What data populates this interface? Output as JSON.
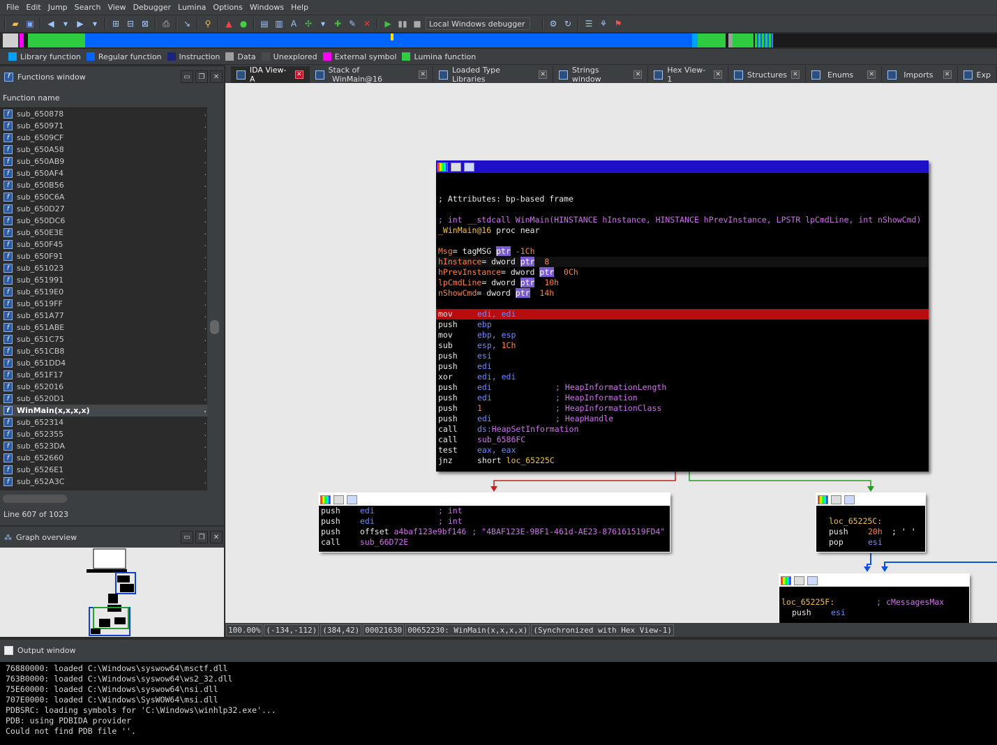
{
  "menu": [
    "File",
    "Edit",
    "Jump",
    "Search",
    "View",
    "Debugger",
    "Lumina",
    "Options",
    "Windows",
    "Help"
  ],
  "toolbar": {
    "debugger": "Local Windows debugger"
  },
  "legend": [
    {
      "label": "Library function",
      "color": "#00a0ff"
    },
    {
      "label": "Regular function",
      "color": "#0064ff"
    },
    {
      "label": "Instruction",
      "color": "#1a237e"
    },
    {
      "label": "Data",
      "color": "#9e9e9e"
    },
    {
      "label": "Unexplored",
      "color": "#4a4a4a"
    },
    {
      "label": "External symbol",
      "color": "#ff00ff"
    },
    {
      "label": "Lumina function",
      "color": "#2ecc40"
    }
  ],
  "functions_window": {
    "title": "Functions window",
    "column": "Function name",
    "items": [
      "sub_650878",
      "sub_650971",
      "sub_6509CF",
      "sub_650A58",
      "sub_650AB9",
      "sub_650AF4",
      "sub_650B56",
      "sub_650C6A",
      "sub_650D27",
      "sub_650DC6",
      "sub_650E3E",
      "sub_650F45",
      "sub_650F91",
      "sub_651023",
      "sub_651991",
      "sub_6519E0",
      "sub_6519FF",
      "sub_651A77",
      "sub_651ABE",
      "sub_651C75",
      "sub_651CB8",
      "sub_651DD4",
      "sub_651F17",
      "sub_652016",
      "sub_6520D1",
      "WinMain(x,x,x,x)",
      "sub_652314",
      "sub_652355",
      "sub_6523DA",
      "sub_652660",
      "sub_6526E1",
      "sub_652A3C"
    ],
    "line_status": "Line 607 of 1023"
  },
  "graph_overview": {
    "title": "Graph overview"
  },
  "tabs": [
    "IDA View-A",
    "Stack of _WinMain@16",
    "Loaded Type Libraries",
    "Strings window",
    "Hex View-1",
    "Structures",
    "Enums",
    "Imports",
    "Exp"
  ],
  "nodes": {
    "main": {
      "attributes": "; Attributes: bp-based frame",
      "proto_a": "; int __stdcall ",
      "proto_name": "WinMain",
      "proto_b": "(HINSTANCE hInstance, HINSTANCE hPrevInstance, LPSTR lpCmdLine, int nShowCmd)",
      "proc_name": "_WinMain@16",
      "proc_tail": " proc near",
      "vars": [
        {
          "name": "Msg",
          "type": "= tagMSG ",
          "ptr": "ptr",
          "val": " -1Ch"
        },
        {
          "name": "hInstance",
          "type": "= dword ",
          "ptr": "ptr",
          "val": "  8"
        },
        {
          "name": "hPrevInstance",
          "type": "= dword ",
          "ptr": "ptr",
          "val": "  0Ch"
        },
        {
          "name": "lpCmdLine",
          "type": "= dword ",
          "ptr": "ptr",
          "val": "  10h"
        },
        {
          "name": "nShowCmd",
          "type": "= dword ",
          "ptr": "ptr",
          "val": "  14h"
        }
      ],
      "code": [
        {
          "m": "mov",
          "a": "edi, edi",
          "c": ""
        },
        {
          "m": "push",
          "a": "ebp",
          "c": ""
        },
        {
          "m": "mov",
          "a": "ebp, esp",
          "c": ""
        },
        {
          "m": "sub",
          "a": "esp, 1Ch",
          "c": ""
        },
        {
          "m": "push",
          "a": "esi",
          "c": ""
        },
        {
          "m": "push",
          "a": "edi",
          "c": ""
        },
        {
          "m": "xor",
          "a": "edi, edi",
          "c": ""
        },
        {
          "m": "push",
          "a": "edi",
          "c": "; HeapInformationLength"
        },
        {
          "m": "push",
          "a": "edi",
          "c": "; HeapInformation"
        },
        {
          "m": "push",
          "a": "1",
          "c": "; HeapInformationClass"
        },
        {
          "m": "push",
          "a": "edi",
          "c": "; HeapHandle"
        },
        {
          "m": "call",
          "a": "ds:HeapSetInformation",
          "c": ""
        },
        {
          "m": "call",
          "a": "sub_6586FC",
          "c": ""
        },
        {
          "m": "test",
          "a": "eax, eax",
          "c": ""
        },
        {
          "m": "jnz",
          "a": "short loc_65225C",
          "c": ""
        }
      ]
    },
    "left": {
      "code": [
        {
          "m": "push",
          "a": "edi",
          "c": "; int"
        },
        {
          "m": "push",
          "a": "edi",
          "c": "; int"
        },
        {
          "m": "push",
          "a": "offset a4baf123e9bf146",
          "c": "; \"4BAF123E-9BF1-461d-AE23-876161519FD4\""
        },
        {
          "m": "call",
          "a": "sub_66D72E",
          "c": ""
        }
      ]
    },
    "right": {
      "label": "loc_65225C:",
      "code": [
        {
          "m": "push",
          "a": "20h",
          "c": "; ' '"
        },
        {
          "m": "pop",
          "a": "esi",
          "c": ""
        }
      ]
    },
    "bottom": {
      "label": "loc_65225F:",
      "label_comment": "; cMessagesMax",
      "code": [
        {
          "m": "push",
          "a": "esi",
          "c": ""
        }
      ]
    }
  },
  "status": [
    "100.00%",
    "(-134,-112)",
    "(384,42)",
    "00021630",
    "00652230: WinMain(x,x,x,x)",
    "(Synchronized with Hex View-1)"
  ],
  "output": {
    "title": "Output window",
    "lines": [
      "76880000: loaded C:\\Windows\\syswow64\\msctf.dll",
      "763B0000: loaded C:\\Windows\\syswow64\\ws2_32.dll",
      "75E60000: loaded C:\\Windows\\syswow64\\nsi.dll",
      "707E0000: loaded C:\\Windows\\SysWOW64\\msi.dll",
      "PDBSRC: loading symbols for 'C:\\Windows\\winhlp32.exe'...",
      "PDB: using PDBIDA provider",
      "Could not find PDB file ''."
    ]
  }
}
